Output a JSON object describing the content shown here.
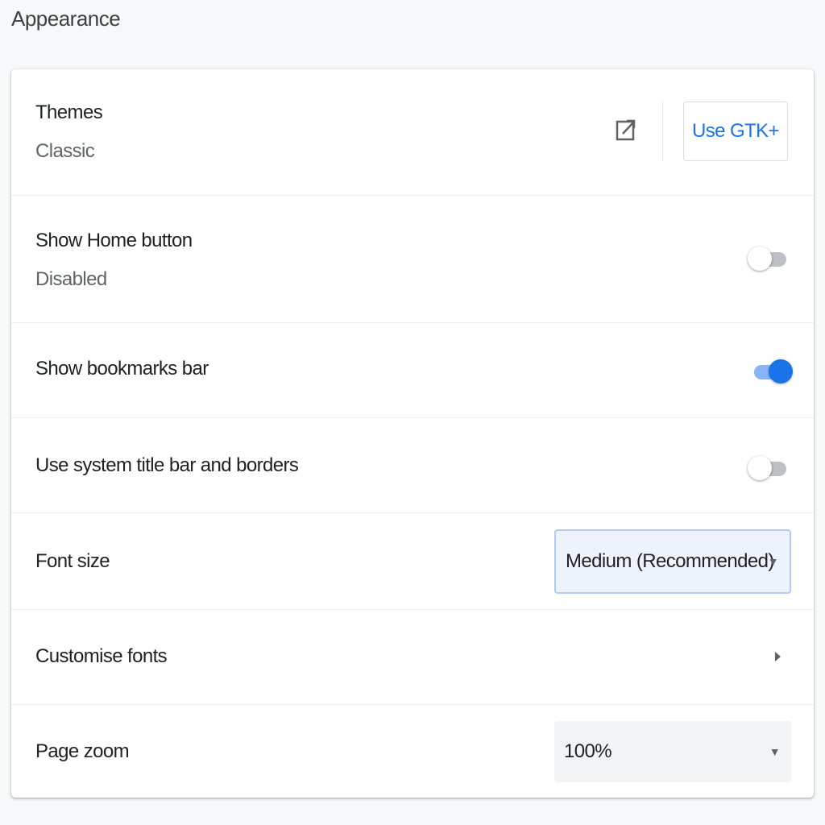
{
  "section": {
    "title": "Appearance"
  },
  "rows": {
    "themes": {
      "label": "Themes",
      "sublabel": "Classic",
      "action_icon": "open-in-new-icon",
      "button_label": "Use GTK+"
    },
    "home_button": {
      "label": "Show Home button",
      "sublabel": "Disabled",
      "enabled": false
    },
    "bookmarks_bar": {
      "label": "Show bookmarks bar",
      "enabled": true
    },
    "system_title_bar": {
      "label": "Use system title bar and borders",
      "enabled": false
    },
    "font_size": {
      "label": "Font size",
      "selected": "Medium (Recommended)"
    },
    "customise_fonts": {
      "label": "Customise fonts",
      "icon": "chevron-right-icon"
    },
    "page_zoom": {
      "label": "Page zoom",
      "selected": "100%"
    }
  },
  "colors": {
    "accent": "#1a73e8",
    "toggle_on_track": "#8ab4f8",
    "toggle_off_track": "#bdc1c6",
    "background": "#f7f8fa"
  }
}
